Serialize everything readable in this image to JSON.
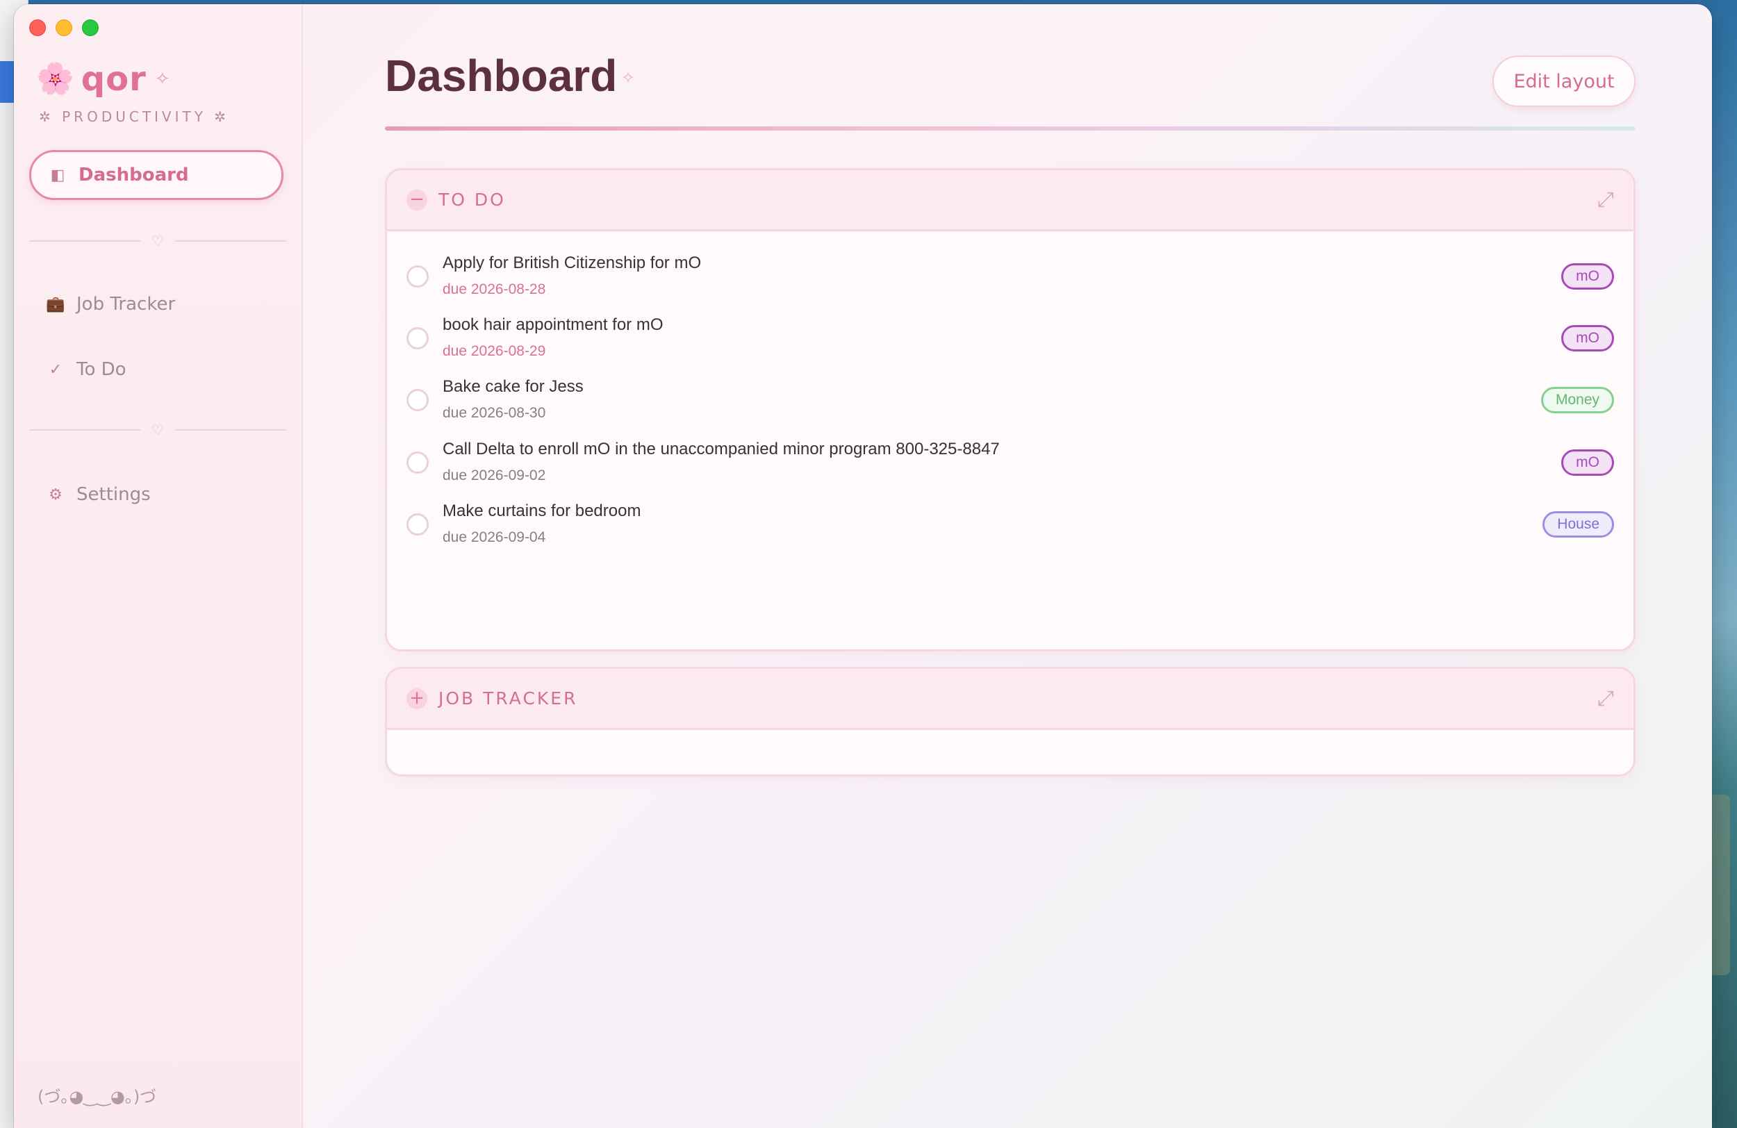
{
  "app": {
    "brand_icon": "🌸",
    "brand_name": "qor",
    "brand_sparkle": "✧",
    "tagline": "✲ PRODUCTIVITY ✲",
    "kaomoji": "(づ｡◕‿‿◕｡)づ"
  },
  "sidebar": {
    "items": [
      {
        "label": "Dashboard",
        "icon": "◧",
        "icon_name": "dashboard-icon",
        "active": true
      },
      {
        "label": "Job Tracker",
        "icon": "💼",
        "icon_name": "briefcase-icon",
        "active": false
      },
      {
        "label": "To Do",
        "icon": "✓",
        "icon_name": "check-icon",
        "active": false
      },
      {
        "label": "Settings",
        "icon": "⚙",
        "icon_name": "gear-icon",
        "active": false
      }
    ],
    "divider_icon": "♡"
  },
  "main": {
    "title": "Dashboard",
    "title_sparkle": "✧",
    "edit_button": "Edit layout",
    "cards": [
      {
        "title": "TO DO",
        "toggle": "−",
        "expand_icon": "⤢",
        "items": [
          {
            "title": "Apply for British Citizenship for mO",
            "due": "due 2026-08-28",
            "tag": "mO",
            "urgent": true
          },
          {
            "title": "book hair appointment for mO",
            "due": "due 2026-08-29",
            "tag": "mO",
            "urgent": true
          },
          {
            "title": "Bake cake for Jess",
            "due": "due 2026-08-30",
            "tag": "Money",
            "urgent": false
          },
          {
            "title": "Call Delta to enroll mO in the unaccompanied minor program 800-325-8847",
            "due": "due 2026-09-02",
            "tag": "mO",
            "urgent": false
          },
          {
            "title": "Make curtains for bedroom",
            "due": "due 2026-09-04",
            "tag": "House",
            "urgent": false
          }
        ]
      },
      {
        "title": "JOB TRACKER",
        "toggle": "+",
        "expand_icon": "⤢"
      }
    ]
  },
  "colors": {
    "accent": "#e0709a",
    "tag_mo": "#a74ab7",
    "tag_money": "#88cf92",
    "tag_house": "#9a8fe3",
    "urgent_due": "#d8709a"
  }
}
